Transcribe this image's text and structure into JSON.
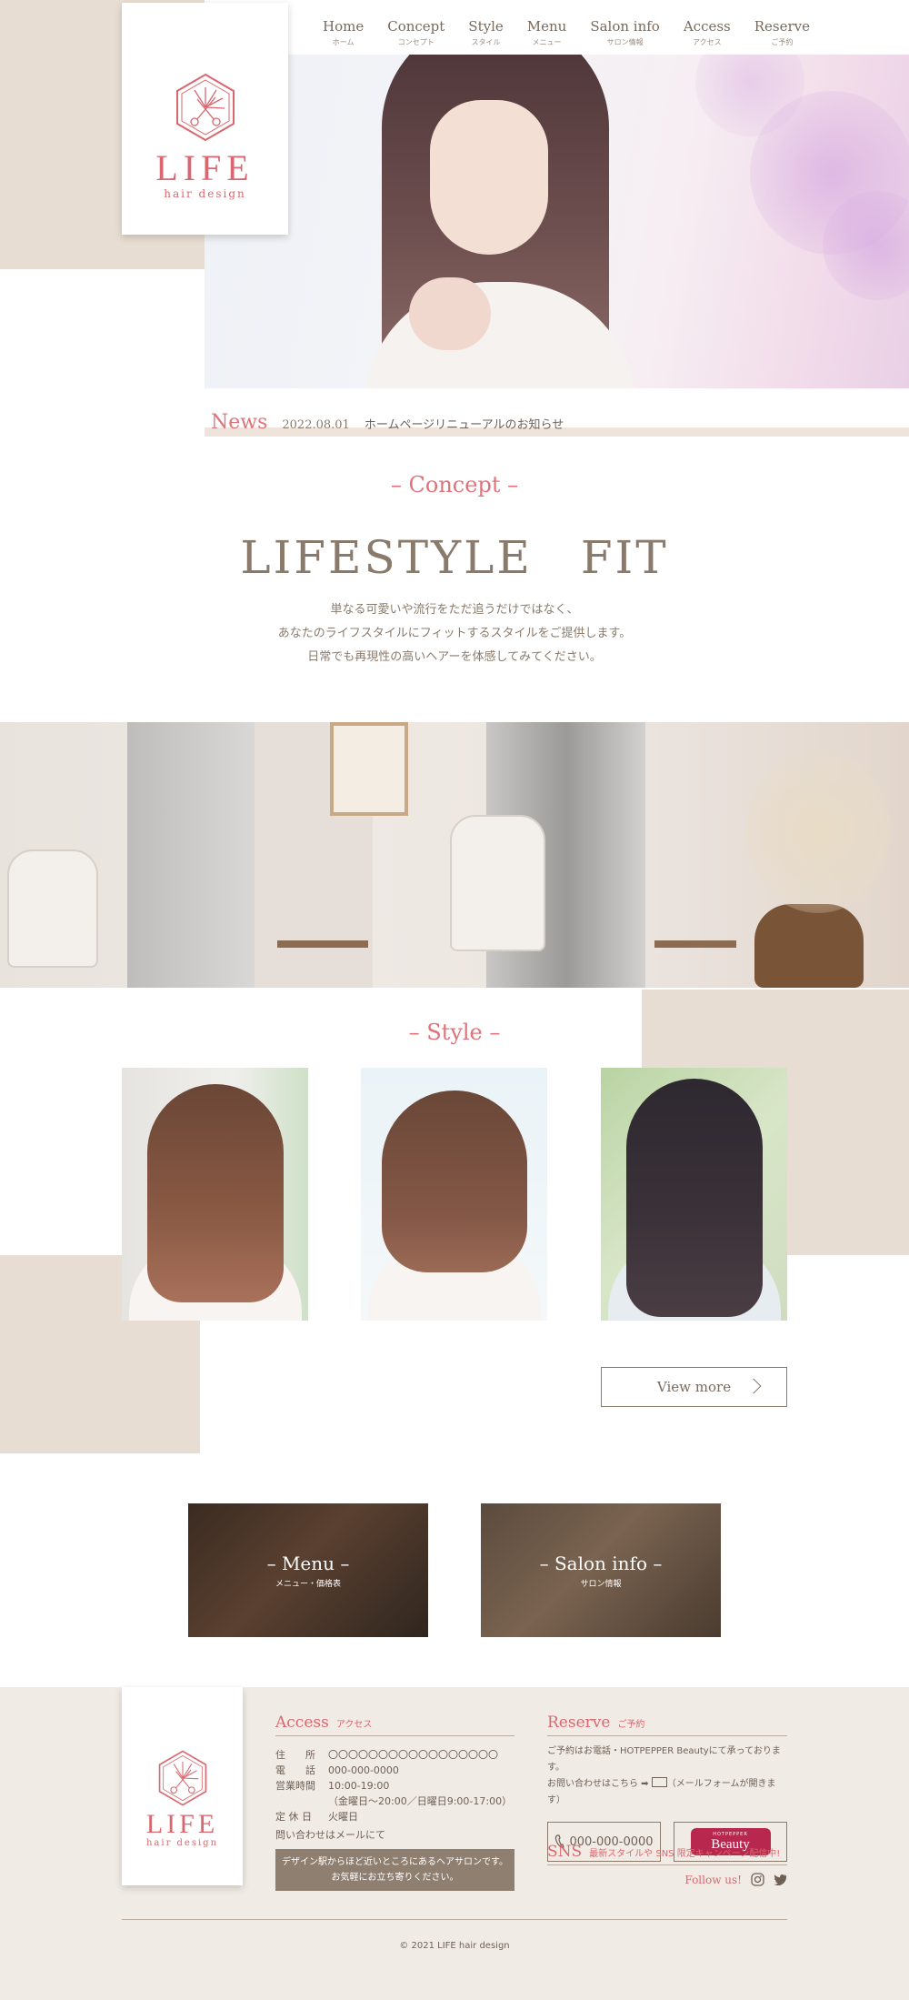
{
  "brand": {
    "name": "LIFE",
    "tagline": "hair design"
  },
  "nav": [
    {
      "en": "Home",
      "jp": "ホーム"
    },
    {
      "en": "Concept",
      "jp": "コンセプト"
    },
    {
      "en": "Style",
      "jp": "スタイル"
    },
    {
      "en": "Menu",
      "jp": "メニュー"
    },
    {
      "en": "Salon info",
      "jp": "サロン情報"
    },
    {
      "en": "Access",
      "jp": "アクセス"
    },
    {
      "en": "Reserve",
      "jp": "ご予約"
    }
  ],
  "news": {
    "label": "News",
    "date": "2022.08.01",
    "text": "ホームページリニューアルのお知らせ"
  },
  "concept": {
    "title": "– Concept –",
    "catch": "LIFESTYLE　FIT",
    "lines": [
      "単なる可愛いや流行をただ追うだけではなく、",
      "あなたのライフスタイルにフィットするスタイルをご提供します。",
      "日常でも再現性の高いヘアーを体感してみてください。"
    ]
  },
  "style": {
    "title": "– Style –",
    "view_more": "View more"
  },
  "cards": [
    {
      "title": "– Menu –",
      "sub": "メニュー・価格表"
    },
    {
      "title": "– Salon info –",
      "sub": "サロン情報"
    }
  ],
  "footer": {
    "access": {
      "title": "Access",
      "title_jp": "アクセス",
      "rows": [
        {
          "k": "住　　所",
          "v": "〇〇〇〇〇〇〇〇〇〇〇〇〇〇〇〇〇"
        },
        {
          "k": "電　　話",
          "v": "000-000-0000"
        },
        {
          "k": "営業時間",
          "v": "10:00-19:00"
        },
        {
          "k": "",
          "v": "（金曜日〜20:00／日曜日9:00-17:00）"
        },
        {
          "k": "定 休 日",
          "v": "火曜日"
        }
      ],
      "note": "問い合わせはメールにて",
      "box_line1": "デザイン駅からほど近いところにあるヘアサロンです。",
      "box_line2": "お気軽にお立ち寄りください。"
    },
    "reserve": {
      "title": "Reserve",
      "title_jp": "ご予約",
      "line1": "ご予約はお電話・HOTPEPPER Beautyにて承っております。",
      "line2_a": "お問い合わせはこちら ➡",
      "line2_b": "（メールフォームが開きます）",
      "tel": "000-000-0000",
      "hp_small": "HOTPEPPER",
      "hp_big": "Beauty"
    },
    "sns": {
      "title": "SNS",
      "title_jp": "最新スタイルや SNS 限定キャンペーン配信中!",
      "follow": "Follow us!"
    },
    "copyright": "© 2021 LIFE hair design"
  }
}
